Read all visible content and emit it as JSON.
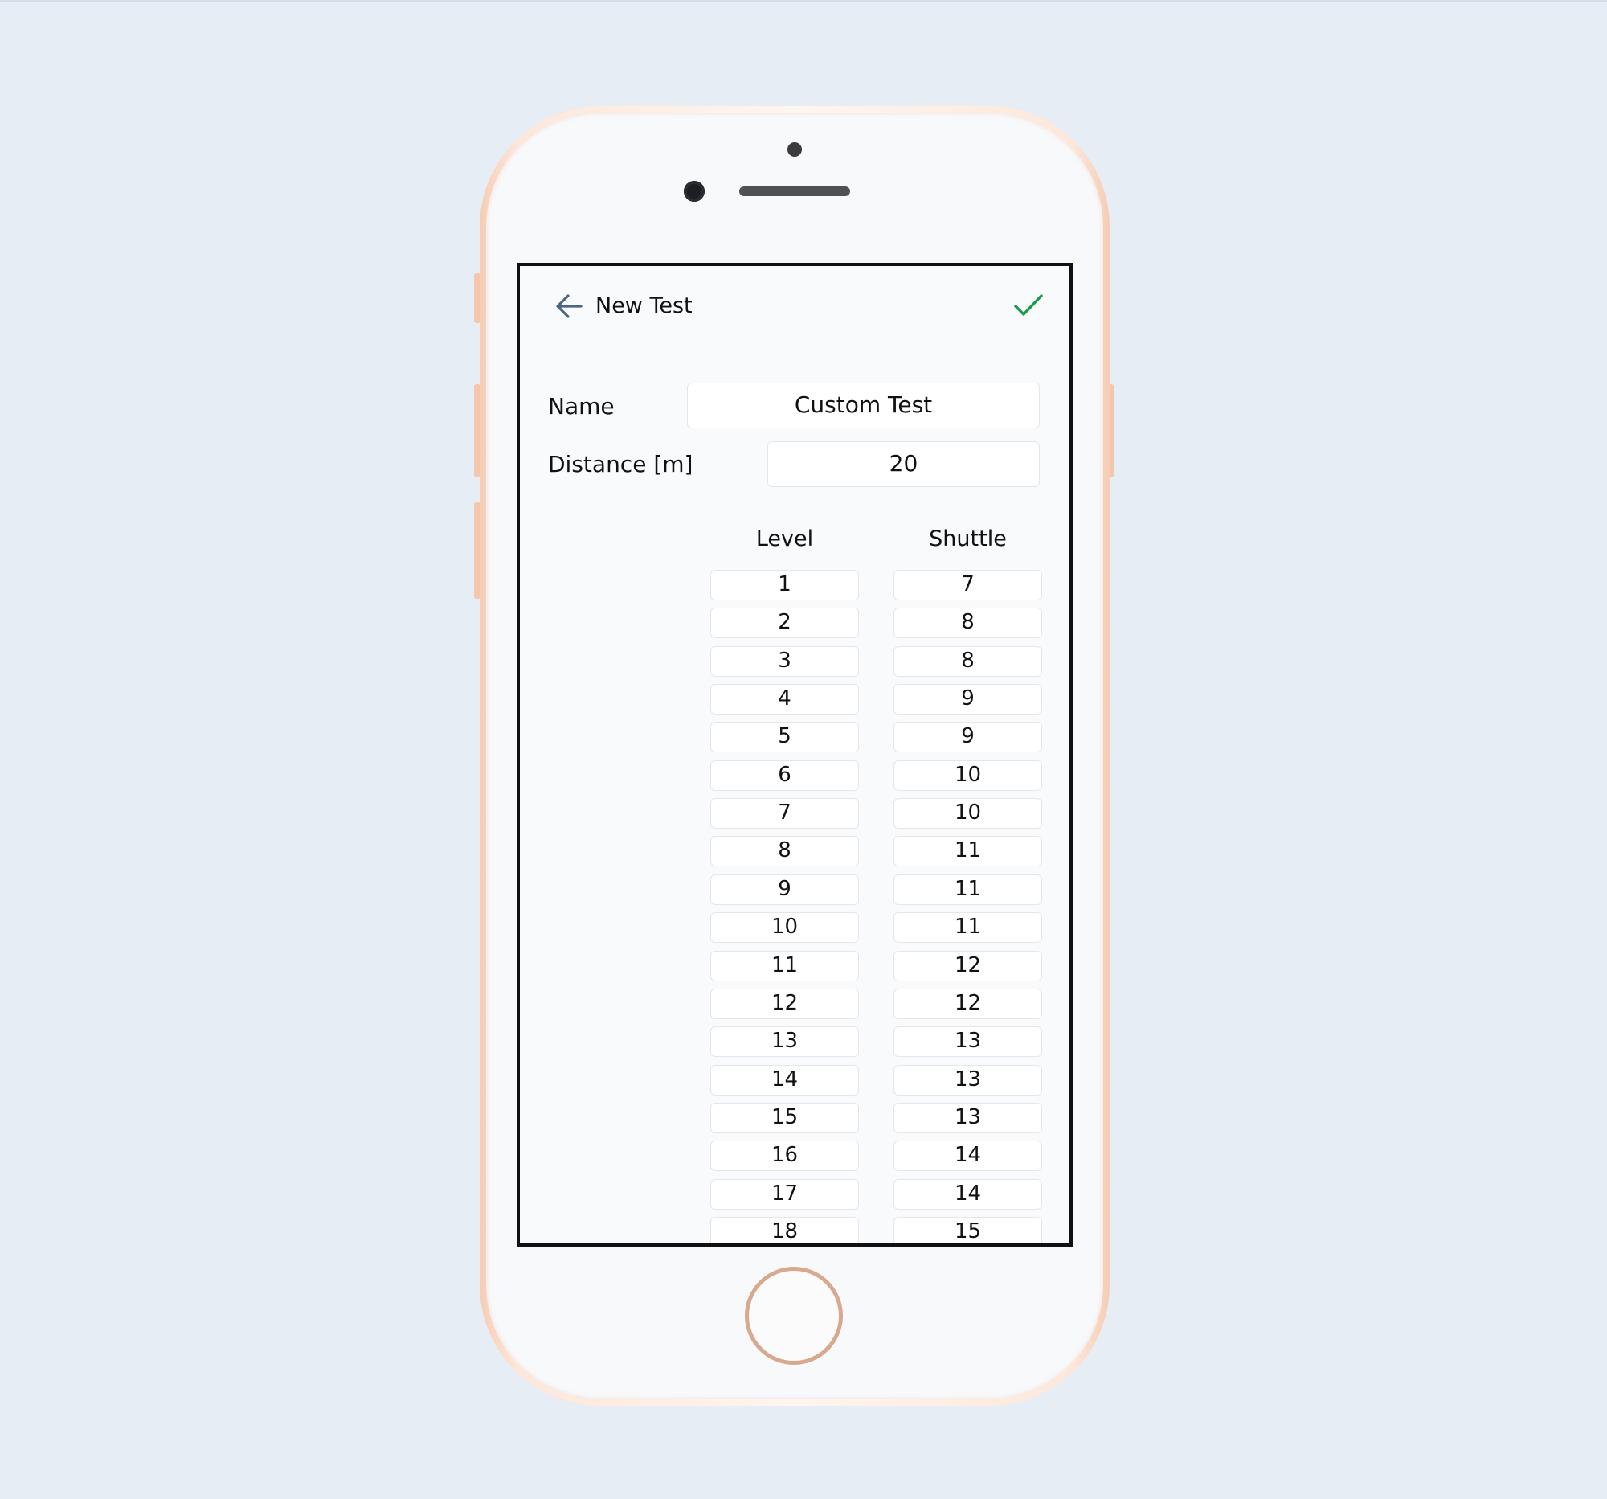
{
  "header": {
    "title": "New Test",
    "back_icon": "arrow-left-icon",
    "confirm_icon": "checkmark-icon",
    "back_icon_color": "#4a6680",
    "confirm_icon_color": "#1a9a4a"
  },
  "form": {
    "name_label": "Name",
    "name_value": "Custom Test",
    "distance_label": "Distance [m]",
    "distance_value": "20"
  },
  "table": {
    "level_header": "Level",
    "shuttle_header": "Shuttle",
    "rows": [
      {
        "level": "1",
        "shuttle": "7"
      },
      {
        "level": "2",
        "shuttle": "8"
      },
      {
        "level": "3",
        "shuttle": "8"
      },
      {
        "level": "4",
        "shuttle": "9"
      },
      {
        "level": "5",
        "shuttle": "9"
      },
      {
        "level": "6",
        "shuttle": "10"
      },
      {
        "level": "7",
        "shuttle": "10"
      },
      {
        "level": "8",
        "shuttle": "11"
      },
      {
        "level": "9",
        "shuttle": "11"
      },
      {
        "level": "10",
        "shuttle": "11"
      },
      {
        "level": "11",
        "shuttle": "12"
      },
      {
        "level": "12",
        "shuttle": "12"
      },
      {
        "level": "13",
        "shuttle": "13"
      },
      {
        "level": "14",
        "shuttle": "13"
      },
      {
        "level": "15",
        "shuttle": "13"
      },
      {
        "level": "16",
        "shuttle": "14"
      },
      {
        "level": "17",
        "shuttle": "14"
      },
      {
        "level": "18",
        "shuttle": "15"
      }
    ]
  }
}
